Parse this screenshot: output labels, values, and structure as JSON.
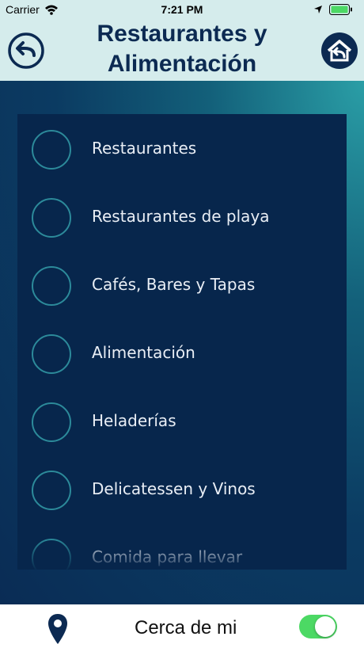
{
  "status_bar": {
    "carrier": "Carrier",
    "time": "7:21 PM",
    "icons": [
      "wifi-icon",
      "location-arrow-icon",
      "battery-icon"
    ]
  },
  "header": {
    "title": "Restaurantes y Alimentación",
    "back_icon": "back-arrow-icon",
    "home_icon": "home-icon"
  },
  "menu": {
    "items": [
      {
        "label": "Restaurantes"
      },
      {
        "label": "Restaurantes de playa"
      },
      {
        "label": "Cafés, Bares y Tapas"
      },
      {
        "label": "Alimentación"
      },
      {
        "label": "Heladerías"
      },
      {
        "label": "Delicatessen y Vinos"
      },
      {
        "label": "Comida para llevar"
      }
    ]
  },
  "footer": {
    "label": "Cerca de mi",
    "toggle_on": true,
    "icon": "map-pin-icon"
  },
  "colors": {
    "header_bg": "#d5ecec",
    "title": "#0c2a52",
    "panel_bg": "#07264c",
    "radio_ring": "#2c8a9a",
    "toggle_on": "#4cd964"
  }
}
